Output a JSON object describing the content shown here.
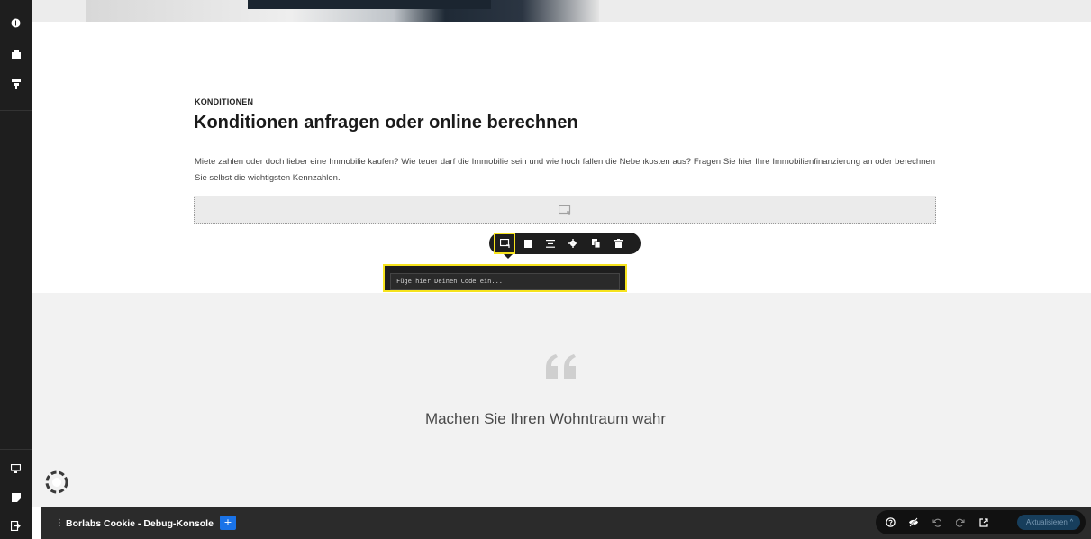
{
  "section": {
    "kicker": "KONDITIONEN",
    "heading": "Konditionen anfragen oder online berechnen",
    "paragraph": "Miete zahlen oder doch lieber eine Immobilie kaufen? Wie teuer darf die Immobilie sein und wie hoch fallen die Nebenkosten aus? Fragen Sie hier Ihre Immobilienfinanzierung an oder berechnen Sie selbst die wichtigsten Kennzahlen."
  },
  "code_popup": {
    "placeholder": "Füge hier Deinen Code ein..."
  },
  "testimonial": {
    "text": "Machen Sie Ihren Wohntraum wahr"
  },
  "debug_bar": {
    "handle": "⋮",
    "title": "Borlabs Cookie - Debug-Konsole",
    "add_label": "+"
  },
  "right_toolbar": {
    "update_label": "Aktualisieren",
    "update_caret": "^"
  },
  "colors": {
    "sidebar_bg": "#1e1e1e",
    "highlight": "#f6e31d",
    "accent_blue": "#1a73e8",
    "update_bg": "#173e5c"
  },
  "icons": {
    "sidebar_top": [
      "add-icon",
      "page-icon",
      "layers-icon"
    ],
    "sidebar_bottom": [
      "monitor-icon",
      "note-icon",
      "exit-icon"
    ],
    "toolbar": [
      "code-icon",
      "square-icon",
      "align-icon",
      "gear-icon",
      "copy-icon",
      "trash-icon"
    ],
    "right_toolbar": [
      "help-icon",
      "visibility-off-icon",
      "undo-icon",
      "redo-icon",
      "external-link-icon"
    ]
  }
}
